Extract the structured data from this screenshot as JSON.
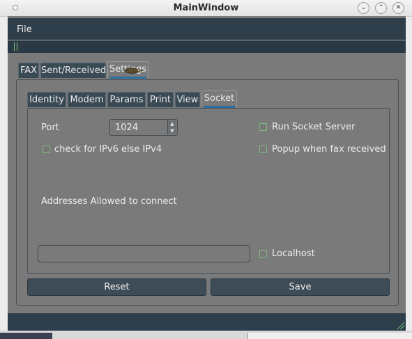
{
  "window": {
    "title": "MainWindow",
    "controls": {
      "minimize": "⌄",
      "maximize": "⌃",
      "close": "✕"
    }
  },
  "menubar": {
    "file": "File"
  },
  "tabs": {
    "outer": [
      "FAX",
      "Sent/Received",
      "Settings"
    ],
    "outer_active": "Settings",
    "inner": [
      "Identity",
      "Modem",
      "Params",
      "Print",
      "View",
      "Socket"
    ],
    "inner_active": "Socket"
  },
  "socket": {
    "port_label": "Port",
    "port_value": "1024",
    "ipv6_label": "check for IPv6 else IPv4",
    "run_server_label": "Run Socket Server",
    "popup_label": "Popup when fax received",
    "addresses_label": "Addresses Allowed to connect",
    "address_value": "",
    "localhost_label": "Localhost"
  },
  "buttons": {
    "reset": "Reset",
    "save": "Save"
  },
  "colors": {
    "accent": "#2a6f9f",
    "checkbox_border": "#7cbc7c",
    "bar": "#2e3e4a"
  }
}
